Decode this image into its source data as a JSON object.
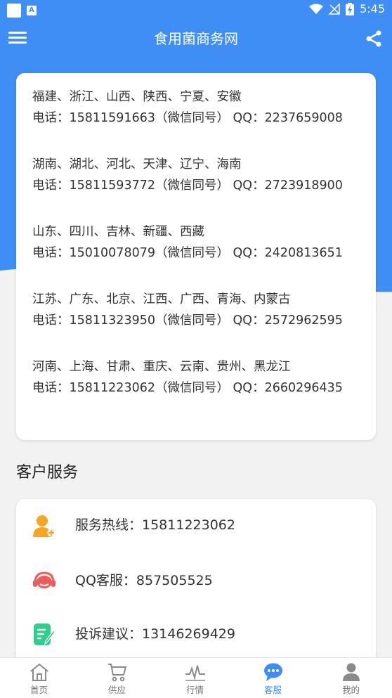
{
  "status_bar": {
    "time": "5:45",
    "notif_glyph": "A"
  },
  "app_bar": {
    "title": "食用菌商务网"
  },
  "regions": [
    {
      "provinces": "福建、浙江、山西、陕西、宁夏、安徽",
      "contact": "电话：15811591663（微信同号） QQ：2237659008"
    },
    {
      "provinces": "湖南、湖北、河北、天津、辽宁、海南",
      "contact": "电话：15811593772（微信同号） QQ：2723918900"
    },
    {
      "provinces": "山东、四川、吉林、新疆、西藏",
      "contact": "电话：15010078079（微信同号） QQ：2420813651"
    },
    {
      "provinces": "江苏、广东、北京、江西、广西、青海、内蒙古",
      "contact": "电话：15811323950（微信同号） QQ：2572962595"
    },
    {
      "provinces": "河南、上海、甘肃、重庆、云南、贵州、黑龙江",
      "contact": "电话：15811223062（微信同号） QQ：2660296435"
    }
  ],
  "customer_service": {
    "title": "客户服务",
    "items": [
      {
        "label": "服务热线：15811223062",
        "icon": "user-plus-icon",
        "color": "#f5a623"
      },
      {
        "label": "QQ客服：857505525",
        "icon": "headset-icon",
        "color": "#ef5b5b"
      },
      {
        "label": "投诉建议：13146269429",
        "icon": "edit-note-icon",
        "color": "#2ecf8c"
      }
    ]
  },
  "tabs": [
    {
      "label": "首页",
      "icon": "home-icon"
    },
    {
      "label": "供应",
      "icon": "cart-icon"
    },
    {
      "label": "行情",
      "icon": "trend-icon"
    },
    {
      "label": "客服",
      "icon": "chat-icon",
      "active": true
    },
    {
      "label": "我的",
      "icon": "profile-icon"
    }
  ],
  "colors": {
    "primary": "#3e8ef5",
    "tab_inactive": "#777777"
  }
}
